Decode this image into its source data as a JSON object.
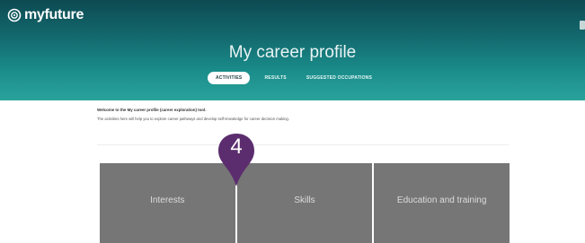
{
  "header": {
    "logo_text": "myfuture",
    "title": "My career profile",
    "tabs": [
      {
        "label": "ACTIVITIES",
        "active": true
      },
      {
        "label": "RESULTS",
        "active": false
      },
      {
        "label": "SUGGESTED OCCUPATIONS",
        "active": false
      }
    ]
  },
  "intro": {
    "welcome": "Welcome to the My career profile (career exploration) tool.",
    "description": "The activities here will help you to explore career pathways and develop self-knowledge for career decision making."
  },
  "cards": [
    {
      "label": "Interests"
    },
    {
      "label": "Skills"
    },
    {
      "label": "Education and training"
    }
  ],
  "marker": {
    "number": "4",
    "color": "#5b2d6e"
  },
  "colors": {
    "hero_dark": "#0d4a52",
    "hero_light": "#2aa39c",
    "card_bg": "#767676"
  }
}
